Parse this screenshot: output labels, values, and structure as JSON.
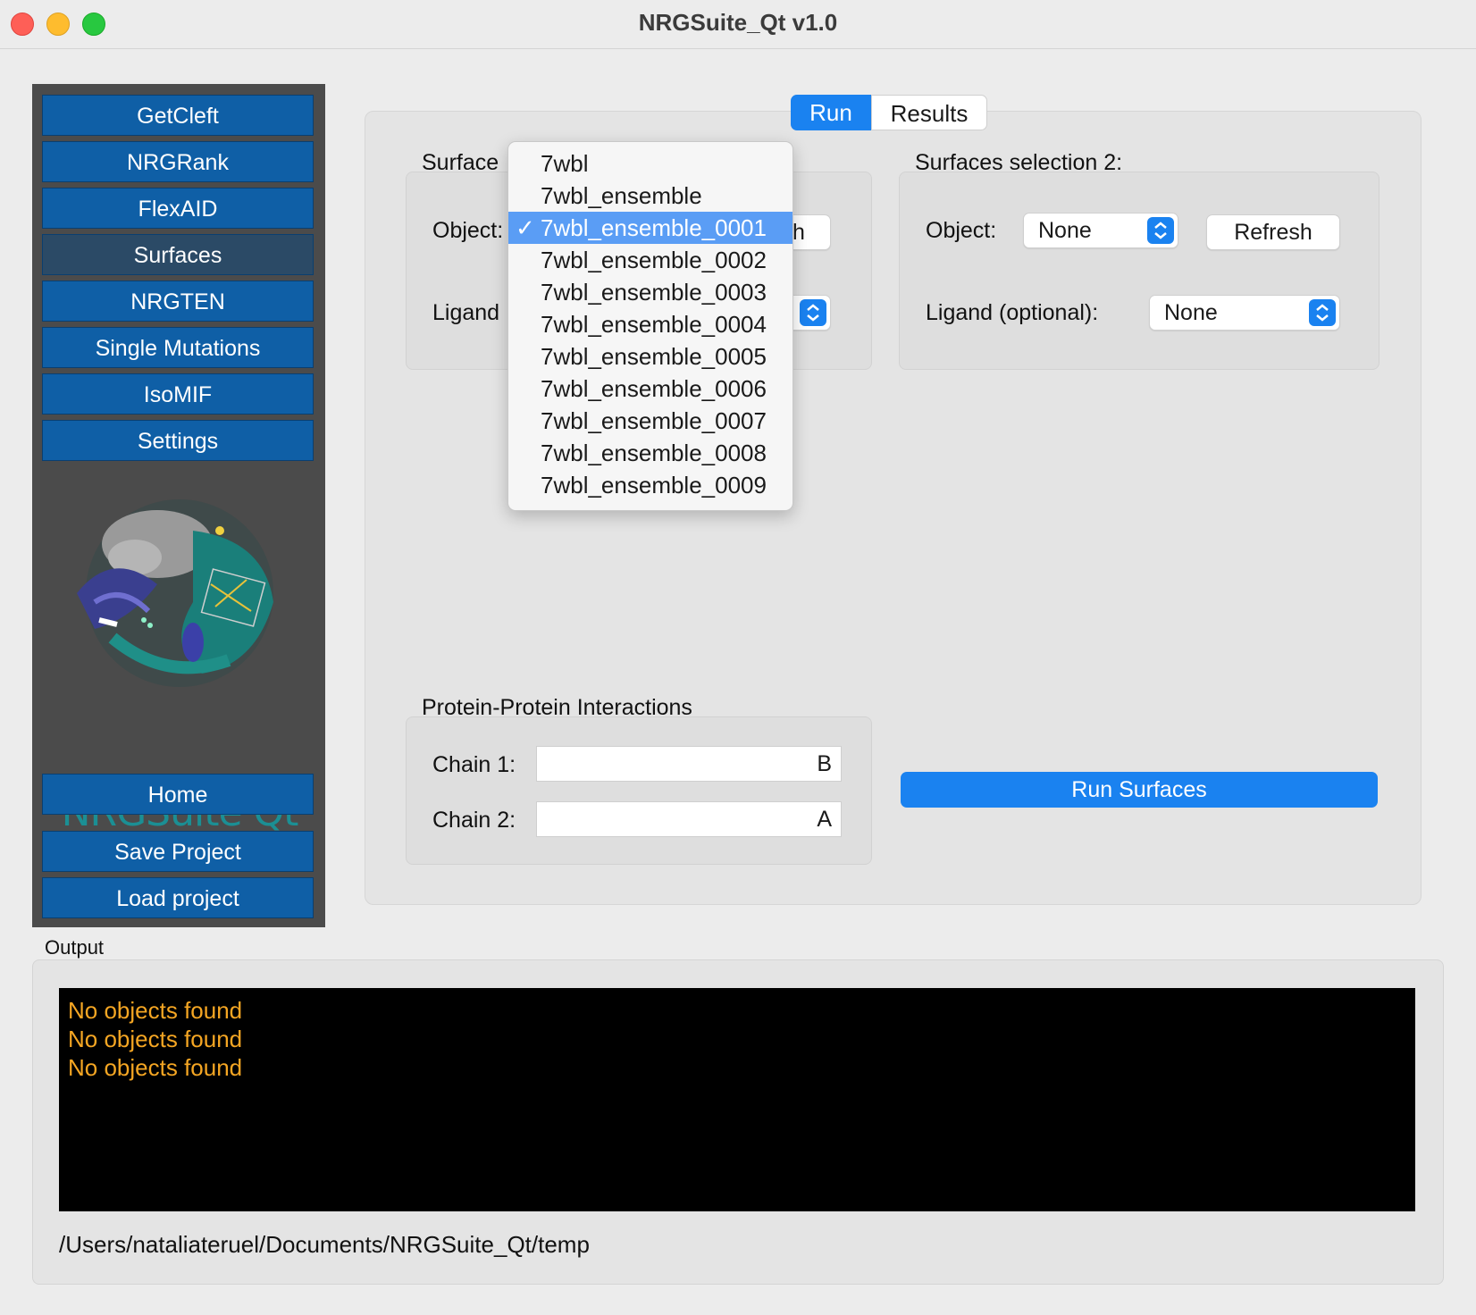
{
  "window": {
    "title": "NRGSuite_Qt v1.0"
  },
  "sidebar": {
    "items": [
      {
        "label": "GetCleft"
      },
      {
        "label": "NRGRank"
      },
      {
        "label": "FlexAID"
      },
      {
        "label": "Surfaces",
        "active": true
      },
      {
        "label": "NRGTEN"
      },
      {
        "label": "Single Mutations"
      },
      {
        "label": "IsoMIF"
      },
      {
        "label": "Settings"
      }
    ],
    "logo_text": "NRGSuite Qt",
    "bottom": [
      {
        "label": "Home"
      },
      {
        "label": "Save Project"
      },
      {
        "label": "Load project"
      }
    ]
  },
  "tabs": [
    {
      "label": "Run",
      "active": true
    },
    {
      "label": "Results"
    }
  ],
  "selection1": {
    "title": "Surface",
    "object_label": "Object:",
    "object_value_fragment": "h",
    "ligand_label": "Ligand"
  },
  "selection2": {
    "title": "Surfaces selection 2:",
    "object_label": "Object:",
    "object_value": "None",
    "refresh_label": "Refresh",
    "ligand_label": "Ligand (optional):",
    "ligand_value": "None"
  },
  "dropdown": {
    "items": [
      "7wbl",
      "7wbl_ensemble",
      "7wbl_ensemble_0001",
      "7wbl_ensemble_0002",
      "7wbl_ensemble_0003",
      "7wbl_ensemble_0004",
      "7wbl_ensemble_0005",
      "7wbl_ensemble_0006",
      "7wbl_ensemble_0007",
      "7wbl_ensemble_0008",
      "7wbl_ensemble_0009"
    ],
    "selected": "7wbl_ensemble_0001",
    "check_glyph": "✓"
  },
  "ppi": {
    "title": "Protein-Protein Interactions",
    "chain1_label": "Chain 1:",
    "chain1_value": "B",
    "chain2_label": "Chain 2:",
    "chain2_value": "A"
  },
  "run_button": "Run Surfaces",
  "output": {
    "label": "Output",
    "lines": [
      "No objects found",
      "No objects found",
      "No objects found"
    ],
    "path": "/Users/nataliateruel/Documents/NRGSuite_Qt/temp"
  },
  "colors": {
    "sidebar_bg": "#4b4b4b",
    "button_blue": "#0f5fa6",
    "accent": "#1a82f0",
    "console_text": "#f5a623",
    "logo_teal": "#1b8f94"
  }
}
